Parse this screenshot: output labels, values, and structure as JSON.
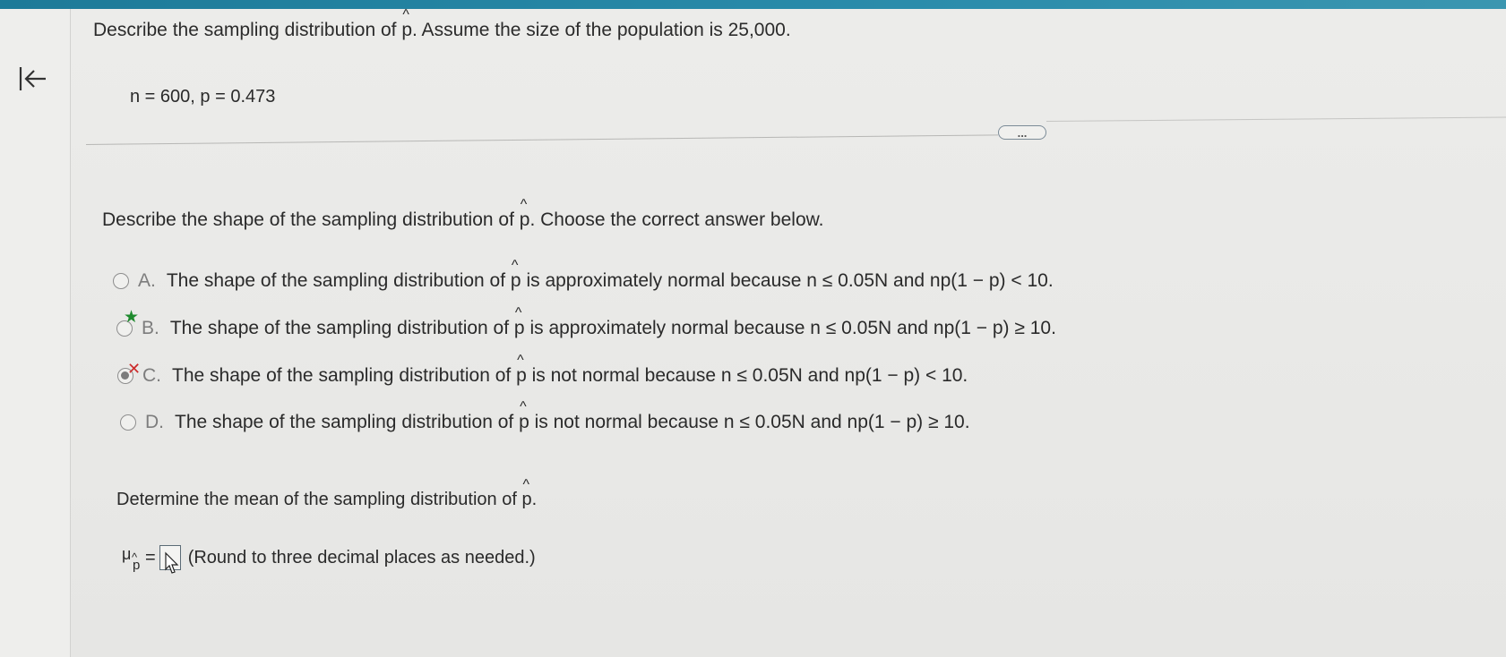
{
  "stem": {
    "prefix": "Describe the sampling distribution of",
    "p_symbol": "p",
    "suffix": ". Assume the size of the population is 25,000."
  },
  "given": "n = 600, p = 0.473",
  "expand_label": "...",
  "shape_question": {
    "prefix": "Describe the shape of the sampling distribution of",
    "p_symbol": "p",
    "suffix": ". Choose the correct answer below."
  },
  "choices": [
    {
      "letter": "A.",
      "prefix": "The shape of the sampling distribution of",
      "p_symbol": "p",
      "suffix": "is approximately normal because n ≤ 0.05N and np(1 − p) < 10.",
      "selected": false,
      "mark": ""
    },
    {
      "letter": "B.",
      "prefix": "The shape of the sampling distribution of",
      "p_symbol": "p",
      "suffix": "is approximately normal because n ≤ 0.05N and np(1 − p) ≥ 10.",
      "selected": false,
      "mark": "★"
    },
    {
      "letter": "C.",
      "prefix": "The shape of the sampling distribution of",
      "p_symbol": "p",
      "suffix": "is not normal because n ≤ 0.05N and np(1 − p) < 10.",
      "selected": true,
      "mark": "✕"
    },
    {
      "letter": "D.",
      "prefix": "The shape of the sampling distribution of",
      "p_symbol": "p",
      "suffix": "is not normal because n ≤ 0.05N and np(1 − p) ≥ 10.",
      "selected": false,
      "mark": ""
    }
  ],
  "mean_question": {
    "prefix": "Determine the mean of the sampling distribution of",
    "p_symbol": "p",
    "suffix": "."
  },
  "mean_answer": {
    "mu": "μ",
    "hat": "^",
    "sub_p": "p",
    "equals": "=",
    "value": "",
    "hint": "(Round to three decimal places as needed.)"
  },
  "colors": {
    "top_bar": "#2a8cab",
    "correct_mark": "#1e8a2d",
    "wrong_mark": "#cc2b2b"
  },
  "icons": {
    "back": "collapse-left-arrow-icon",
    "cursor": "mouse-pointer-icon"
  }
}
